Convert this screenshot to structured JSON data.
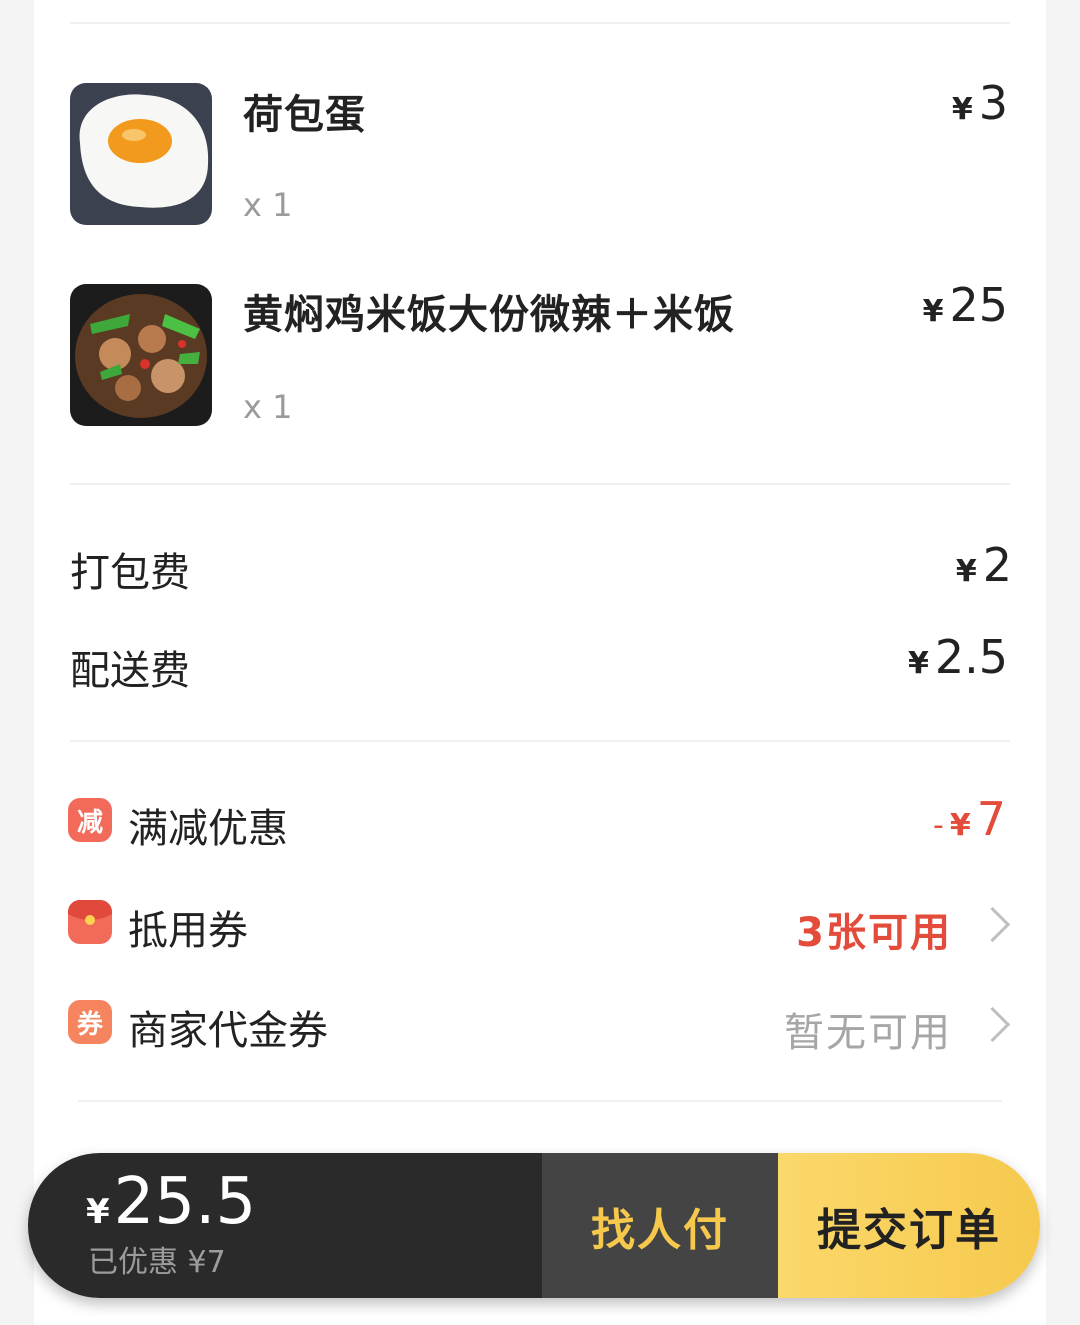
{
  "items": [
    {
      "name": "荷包蛋",
      "qty": "x 1",
      "currency": "¥",
      "price": "3",
      "image": "fried-egg-image"
    },
    {
      "name": "黄焖鸡米饭大份微辣＋米饭",
      "qty": "x 1",
      "currency": "¥",
      "price": "25",
      "image": "braised-chicken-rice-image"
    }
  ],
  "fees": [
    {
      "label": "打包费",
      "currency": "¥",
      "amount": "2"
    },
    {
      "label": "配送费",
      "currency": "¥",
      "amount": "2.5"
    }
  ],
  "discounts": {
    "full_reduction": {
      "label": "满减优惠",
      "badge": "减",
      "prefix": "-",
      "currency": "¥",
      "amount": "7"
    },
    "coupon": {
      "label": "抵用券",
      "status": "3张可用"
    },
    "merchant_voucher": {
      "label": "商家代金券",
      "badge": "券",
      "status": "暂无可用"
    }
  },
  "paybar": {
    "currency": "¥",
    "total": "25.5",
    "saved": "已优惠 ¥7",
    "pay_for_me_label": "找人付",
    "submit_label": "提交订单"
  },
  "colors": {
    "accent_red": "#e34b3a",
    "badge_orange": "#f5845f",
    "submit_yellow": "#f6c94d",
    "paybar_dark": "#2a2a2a"
  }
}
